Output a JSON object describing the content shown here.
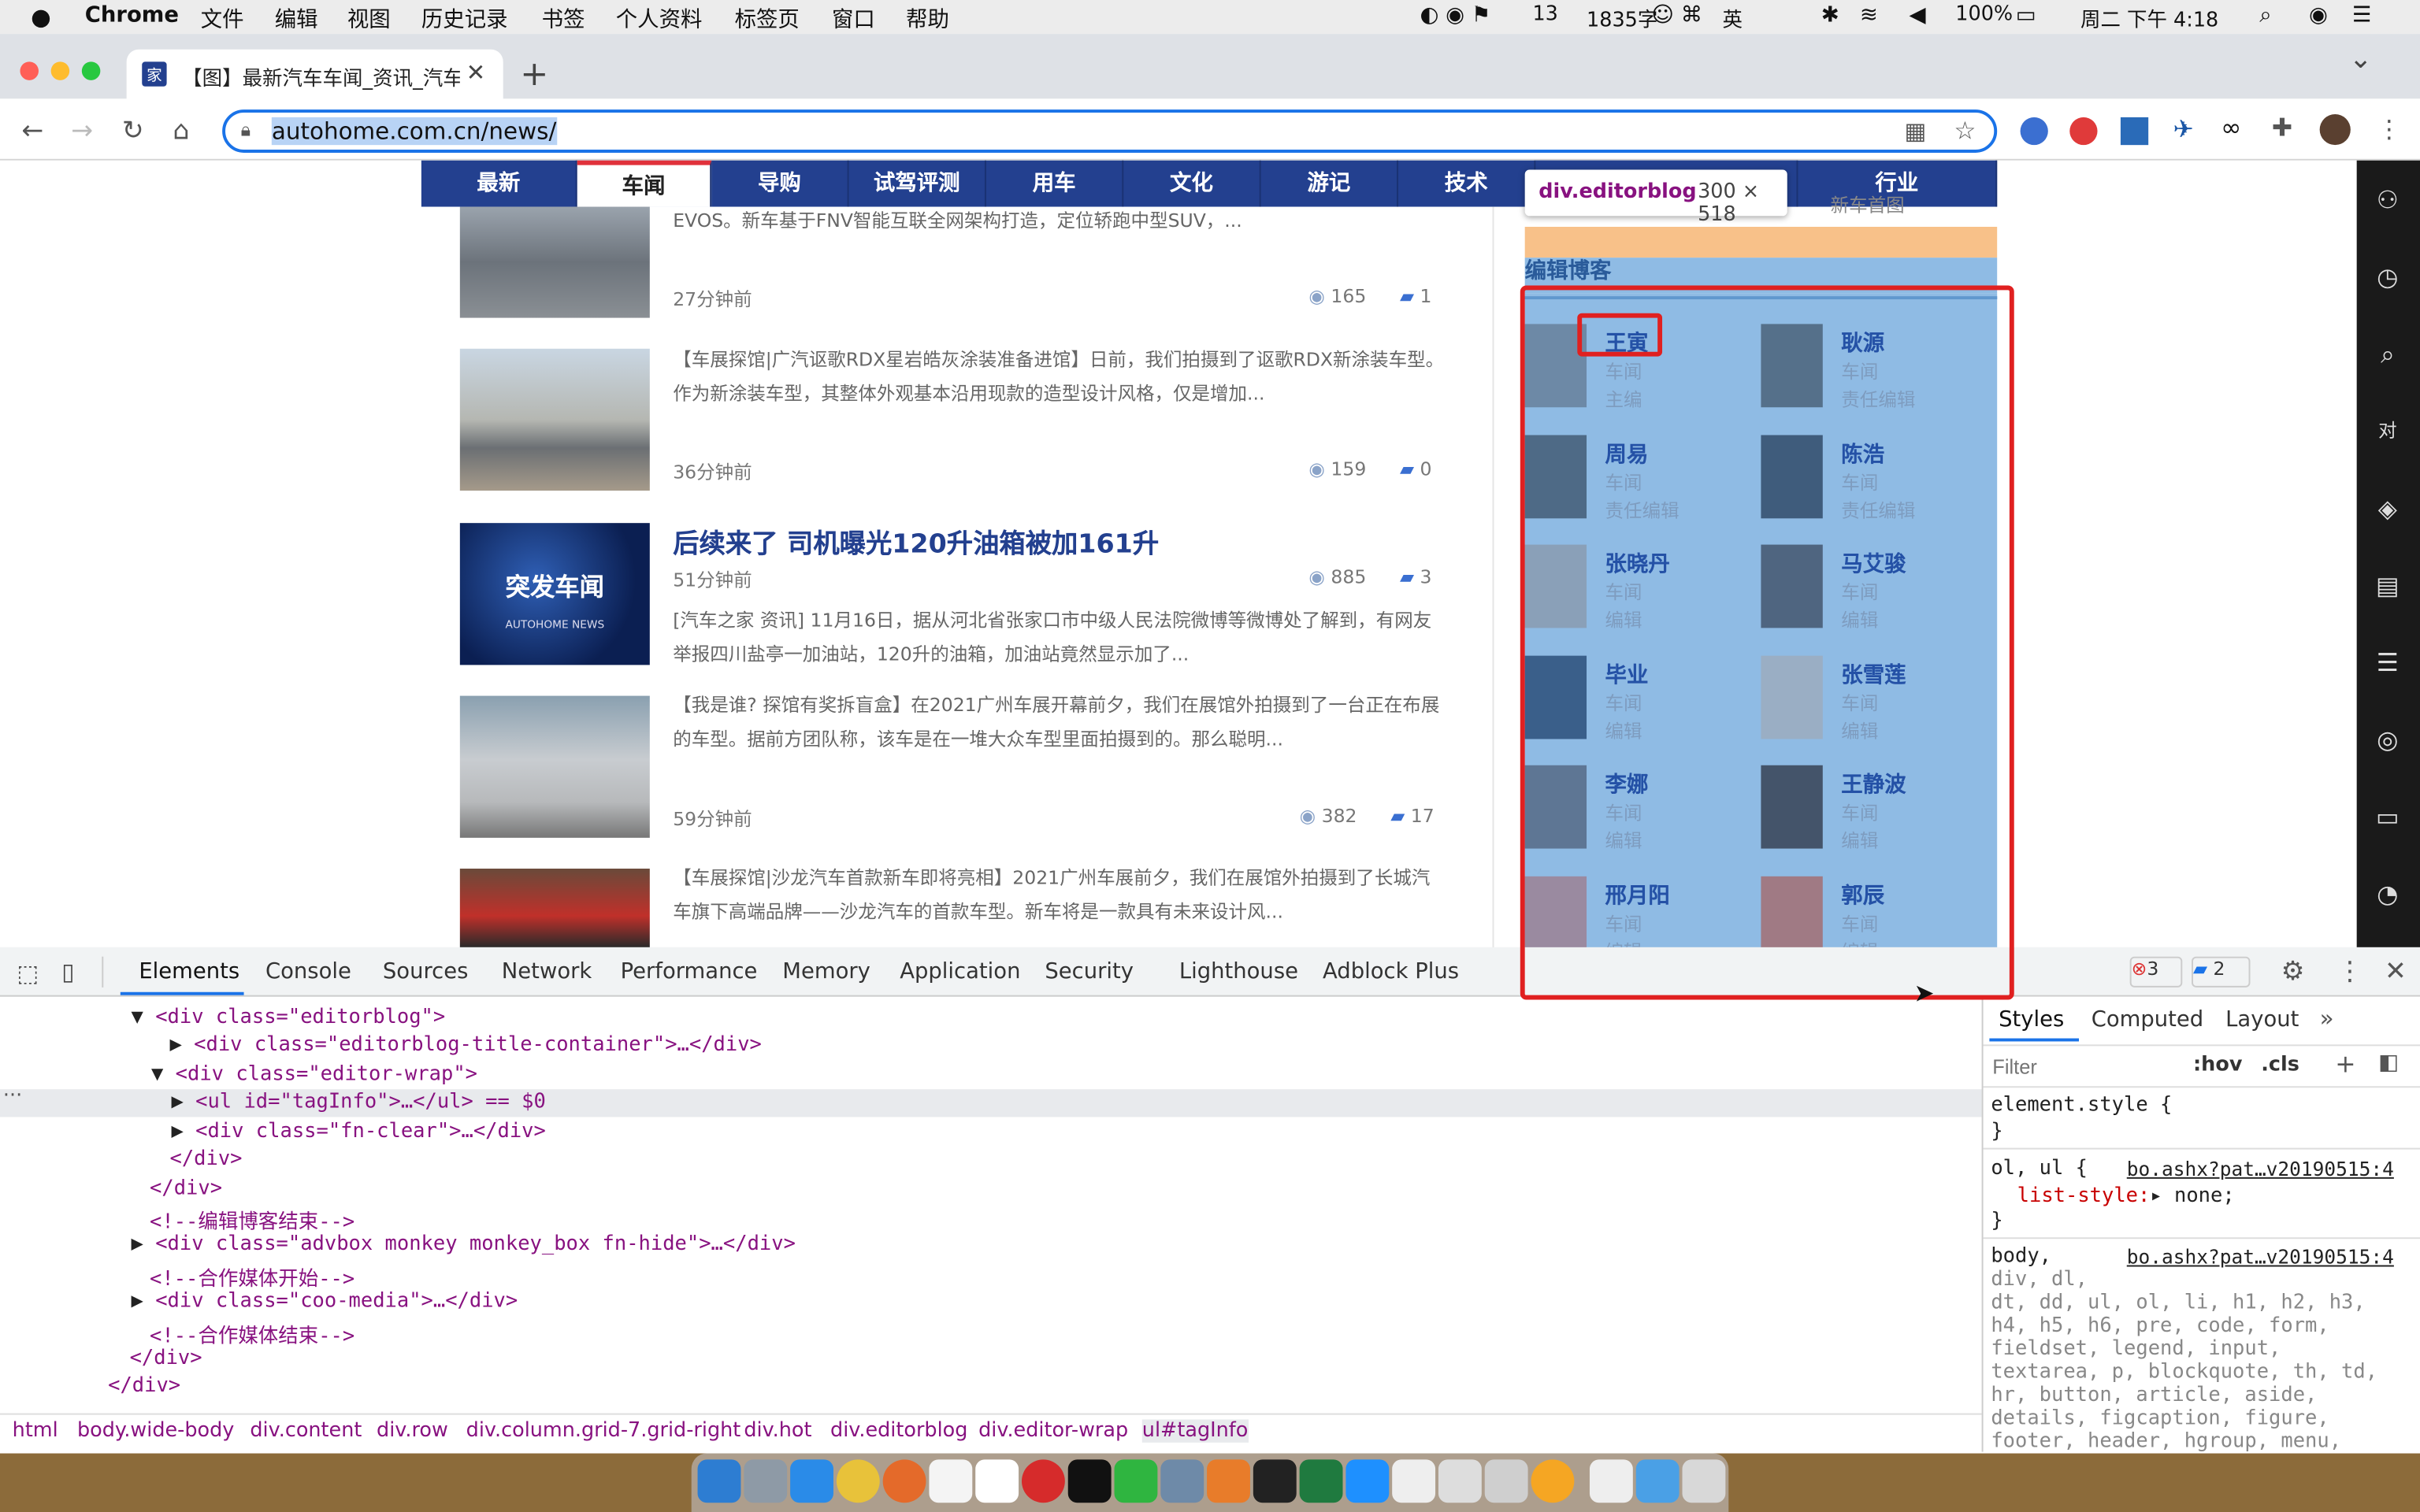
{
  "menubar": {
    "apple": "",
    "items": [
      "Chrome",
      "文件",
      "编辑",
      "视图",
      "历史记录",
      "书签",
      "个人资料",
      "标签页",
      "窗口",
      "帮助"
    ],
    "status": {
      "count13": "13",
      "chars": "1835字",
      "ime": "英",
      "battery": "100%",
      "datetime": "周二 下午 4:18"
    }
  },
  "browser": {
    "tab_title": "【图】最新汽车车闻_资讯_汽车之",
    "new_tab": "+",
    "url": "autohome.com.cn/news/"
  },
  "site_nav": {
    "items": [
      "最新",
      "车闻",
      "导购",
      "试驾评测",
      "用车",
      "文化",
      "游记",
      "技术",
      "行业"
    ],
    "active": "车闻"
  },
  "tooltip": {
    "selector": "div.editorblog",
    "size": "300 × 518"
  },
  "articles": [
    {
      "excerpt": "EVOS。新车基于FNV智能互联全网架构打造，定位轿跑中型SUV，...",
      "time": "27分钟前",
      "views": "165",
      "comments": "1"
    },
    {
      "excerpt": "【车展探馆|广汽讴歌RDX星岩皓灰涂装准备进馆】日前，我们拍摄到了讴歌RDX新涂装车型。作为新涂装车型，其整体外观基本沿用现款的造型设计风格，仅是增加...",
      "time": "36分钟前",
      "views": "159",
      "comments": "0"
    },
    {
      "title": "后续来了 司机曝光120升油箱被加161升",
      "thumb_text": "突发车闻",
      "thumb_sub": "AUTOHOME NEWS",
      "time": "51分钟前",
      "excerpt": "[汽车之家 资讯] 11月16日，据从河北省张家口市中级人民法院微博等微博处了解到，有网友举报四川盐亭一加油站，120升的油箱，加油站竟然显示加了...",
      "views": "885",
      "comments": "3"
    },
    {
      "excerpt": "【我是谁? 探馆有奖拆盲盒】在2021广州车展开幕前夕，我们在展馆外拍摄到了一台正在布展的车型。据前方团队称，该车是在一堆大众车型里面拍摄到的。那么聪明...",
      "time": "59分钟前",
      "views": "382",
      "comments": "17"
    },
    {
      "excerpt": "【车展探馆|沙龙汽车首款新车即将亮相】2021广州车展前夕，我们在展馆外拍摄到了长城汽车旗下高端品牌——沙龙汽车的首款车型。新车将是一款具有未来设计风..."
    }
  ],
  "editorblog": {
    "title": "编辑博客",
    "top_link": "新车首图",
    "editors": [
      {
        "name": "王寅",
        "dept": "车闻",
        "role": "主编"
      },
      {
        "name": "耿源",
        "dept": "车闻",
        "role": "责任编辑"
      },
      {
        "name": "周易",
        "dept": "车闻",
        "role": "责任编辑"
      },
      {
        "name": "陈浩",
        "dept": "车闻",
        "role": "责任编辑"
      },
      {
        "name": "张晓丹",
        "dept": "车闻",
        "role": "编辑"
      },
      {
        "name": "马艾骏",
        "dept": "车闻",
        "role": "编辑"
      },
      {
        "name": "毕业",
        "dept": "车闻",
        "role": "编辑"
      },
      {
        "name": "张雪莲",
        "dept": "车闻",
        "role": "编辑"
      },
      {
        "name": "李娜",
        "dept": "车闻",
        "role": "编辑"
      },
      {
        "name": "王静波",
        "dept": "车闻",
        "role": "编辑"
      },
      {
        "name": "邢月阳",
        "dept": "车闻",
        "role": "编辑"
      },
      {
        "name": "郭辰",
        "dept": "车闻",
        "role": "编辑"
      }
    ]
  },
  "devtools": {
    "tabs": [
      "Elements",
      "Console",
      "Sources",
      "Network",
      "Performance",
      "Memory",
      "Application",
      "Security",
      "Lighthouse",
      "Adblock Plus"
    ],
    "active_tab": "Elements",
    "errors": "3",
    "messages": "2",
    "dom_lines": [
      "<div class=\"editorblog\">",
      "<div class=\"editorblog-title-container\">…</div>",
      "<div class=\"editor-wrap\">",
      "<ul id=\"tagInfo\">…</ul> == $0",
      "<div class=\"fn-clear\">…</div>",
      "</div>",
      "</div>",
      "<!--编辑博客结束-->",
      "<div class=\"advbox monkey monkey_box fn-hide\">…</div>",
      "<!--合作媒体开始-->",
      "<div class=\"coo-media\">…</div>",
      "<!--合作媒体结束-->",
      "</div>",
      "</div>"
    ],
    "styles_tabs": [
      "Styles",
      "Computed",
      "Layout",
      "»"
    ],
    "filter_placeholder": "Filter",
    "hov": ":hov",
    "cls": ".cls",
    "rules": [
      {
        "selector": "element.style {",
        "close": "}"
      },
      {
        "selector": "ol, ul {",
        "source": "bo.ashx?pat…v20190515:4",
        "prop": "list-style:",
        "val": " none;",
        "close": "}"
      },
      {
        "selector": "body,",
        "source": "bo.ashx?pat…v20190515:4",
        "lines": [
          "div, dl,",
          "dt, dd, ul, ol, li, h1, h2, h3,",
          "h4, h5, h6, pre, code, form,",
          "fieldset, legend, input,",
          "textarea, p, blockquote, th, td,",
          "hr, button, article, aside,",
          "details, figcaption, figure,",
          "footer, header, hgroup, menu,"
        ]
      }
    ],
    "breadcrumbs": [
      "html",
      "body.wide-body",
      "div.content",
      "div.row",
      "div.column.grid-7.grid-right",
      "div.hot",
      "div.editorblog",
      "div.editor-wrap",
      "ul#tagInfo"
    ]
  },
  "colors": {
    "nav": "#23408f",
    "highlight": "#6fa8dc",
    "accent_red": "#e0313b"
  }
}
